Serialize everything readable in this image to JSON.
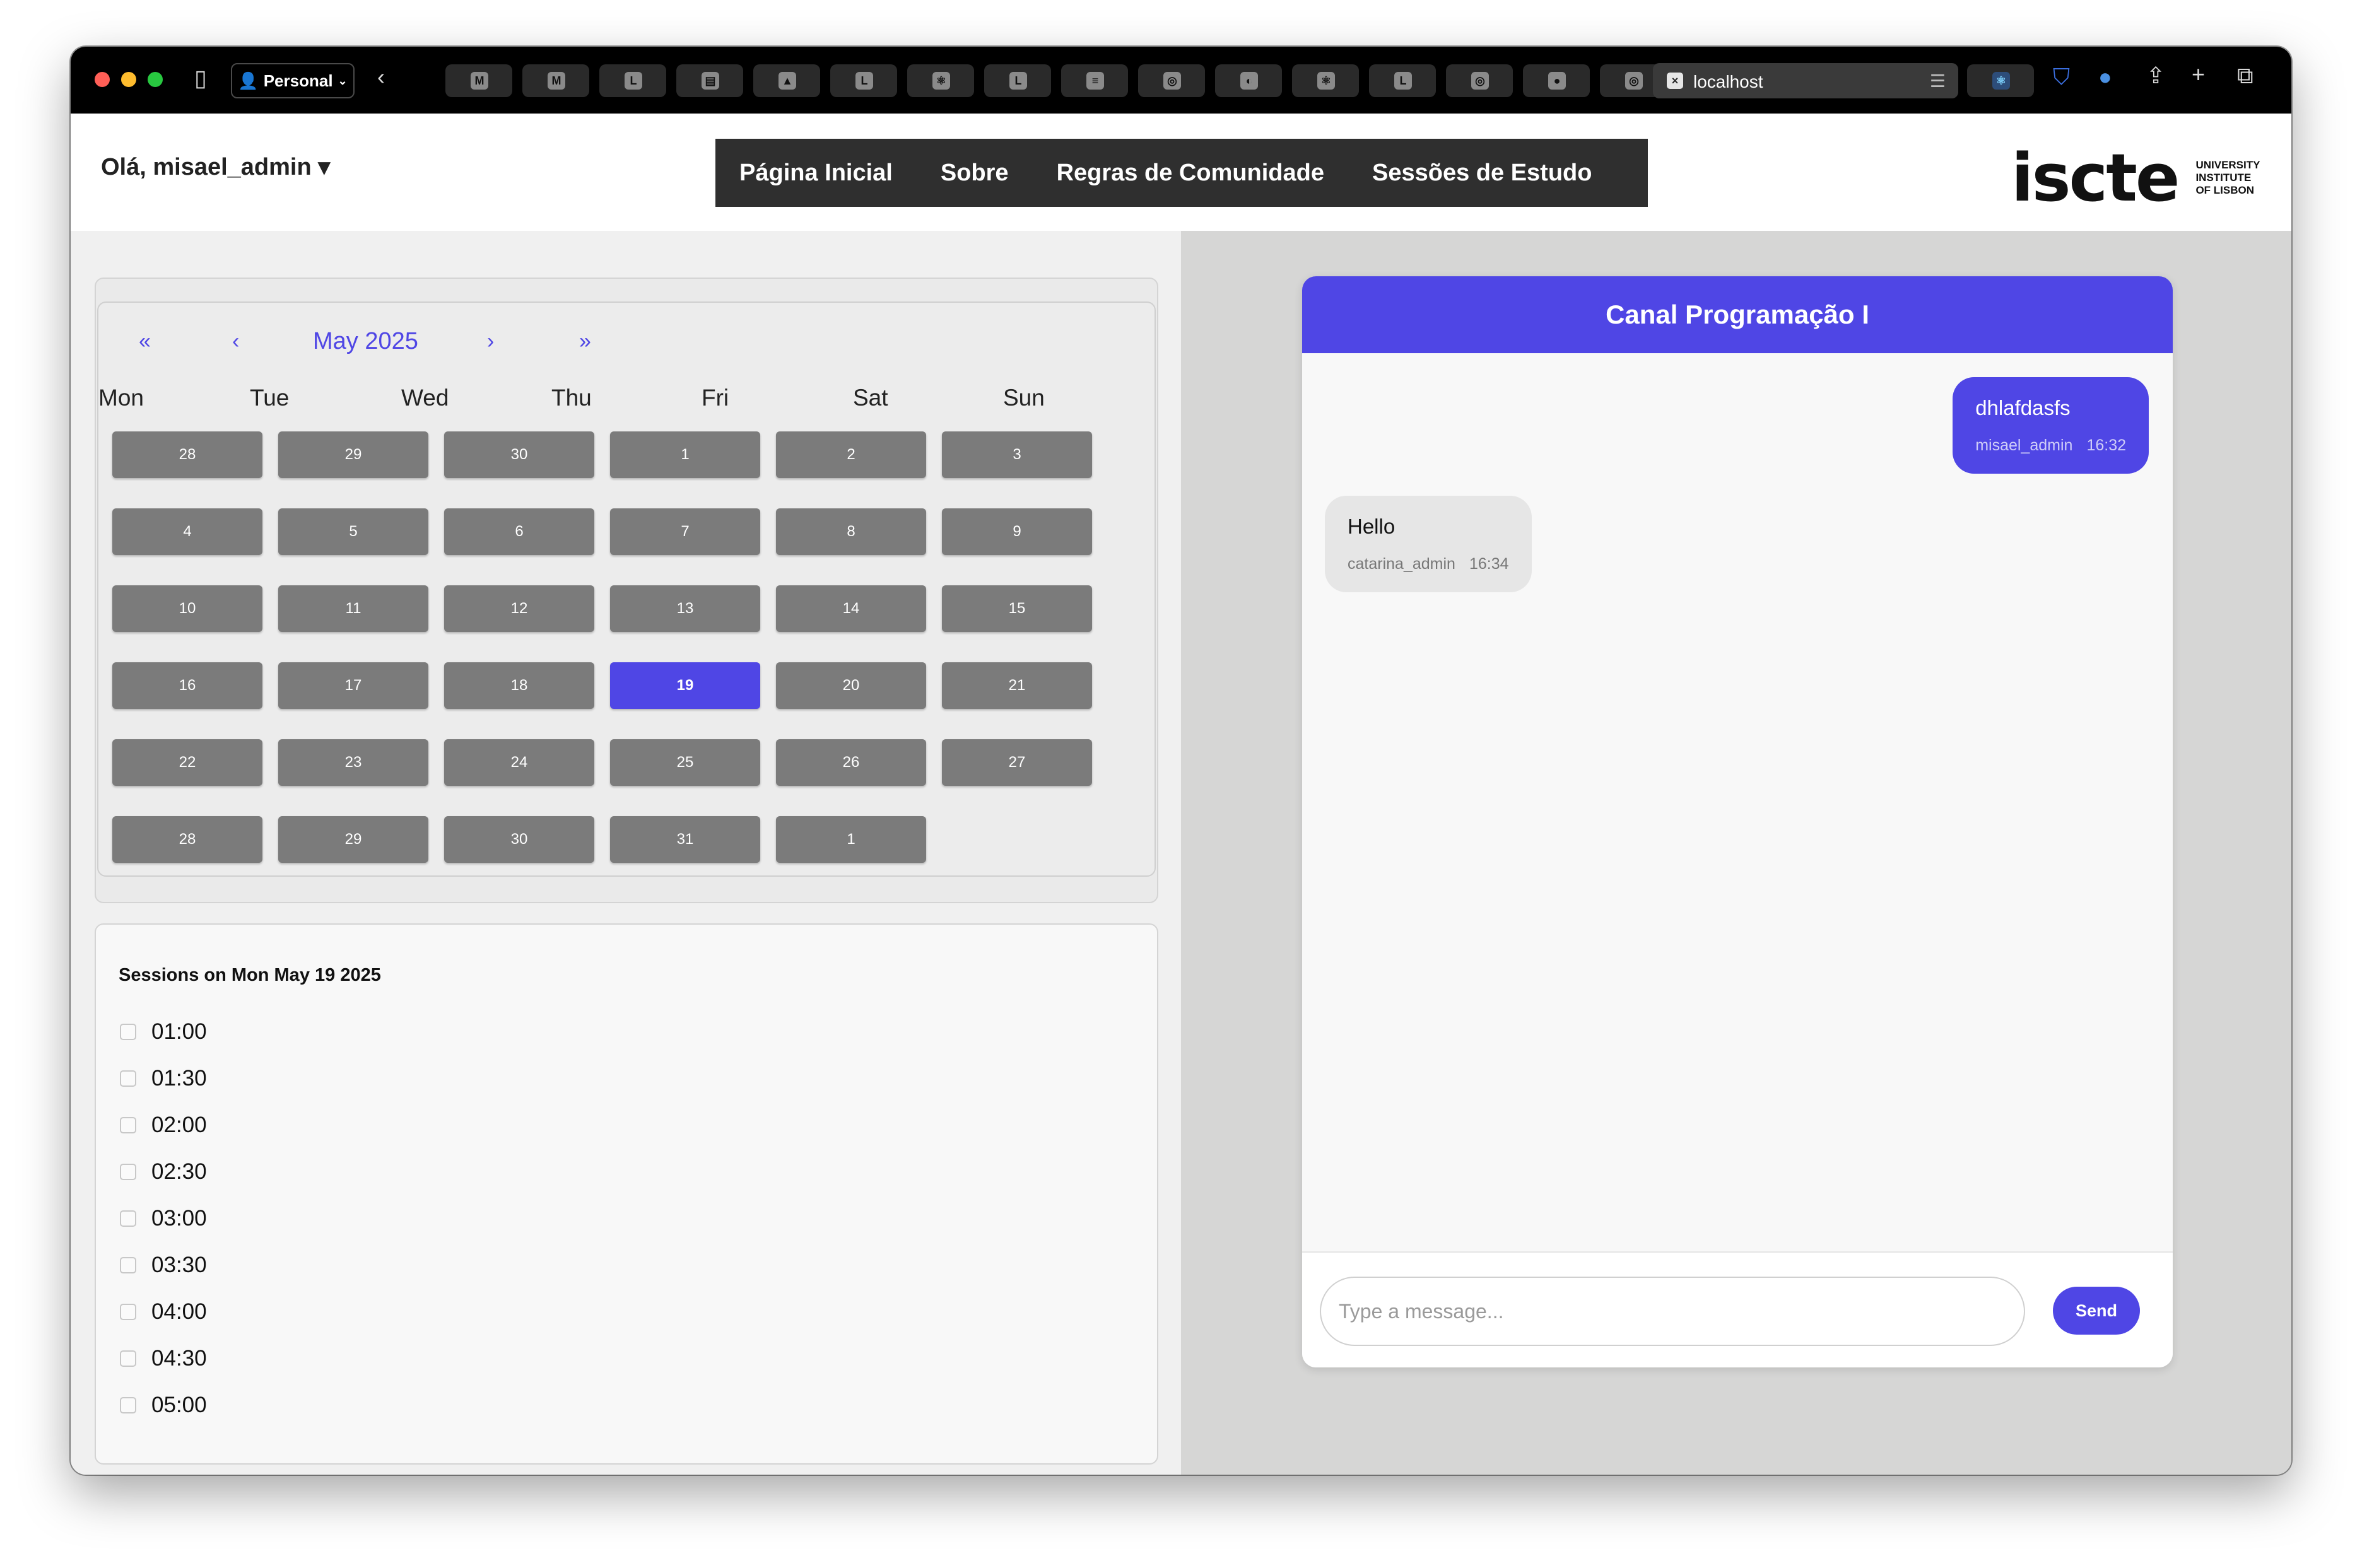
{
  "browser": {
    "profile_label": "Personal",
    "active_tab_title": "localhost",
    "tabs": [
      {
        "icon": "medium-icon",
        "label": "M"
      },
      {
        "icon": "medium-icon",
        "label": "M"
      },
      {
        "icon": "letter-l-icon",
        "label": "L"
      },
      {
        "icon": "book-icon",
        "label": "▤"
      },
      {
        "icon": "purple-app-icon",
        "label": "▲"
      },
      {
        "icon": "letter-l-icon",
        "label": "L"
      },
      {
        "icon": "react-icon",
        "label": "⚛"
      },
      {
        "icon": "letter-l-icon",
        "label": "L"
      },
      {
        "icon": "stackoverflow-icon",
        "label": "≡"
      },
      {
        "icon": "openai-icon",
        "label": "◎"
      },
      {
        "icon": "duckduckgo-icon",
        "label": "◐"
      },
      {
        "icon": "react-icon",
        "label": "⚛"
      },
      {
        "icon": "letter-l-icon",
        "label": "L"
      },
      {
        "icon": "openai-icon",
        "label": "◎"
      },
      {
        "icon": "red-app-icon",
        "label": "●"
      },
      {
        "icon": "openai-icon",
        "label": "◎"
      }
    ]
  },
  "header": {
    "greeting": "Olá, misael_admin ▾",
    "nav": [
      "Página Inicial",
      "Sobre",
      "Regras de Comunidade",
      "Sessões de Estudo"
    ],
    "logo_word": "iscte",
    "logo_sub": [
      "UNIVERSITY",
      "INSTITUTE",
      "OF LISBON"
    ]
  },
  "calendar": {
    "nav_first": "«",
    "nav_prev": "‹",
    "month_label": "May 2025",
    "nav_next": "›",
    "nav_last": "»",
    "weekdays": [
      "Mon",
      "Tue",
      "Wed",
      "Thu",
      "Fri",
      "Sat",
      "Sun"
    ],
    "weeks": [
      [
        "28",
        "29",
        "30",
        "1",
        "2",
        "3"
      ],
      [
        "4",
        "5",
        "6",
        "7",
        "8",
        "9"
      ],
      [
        "10",
        "11",
        "12",
        "13",
        "14",
        "15"
      ],
      [
        "16",
        "17",
        "18",
        "19",
        "20",
        "21"
      ],
      [
        "22",
        "23",
        "24",
        "25",
        "26",
        "27"
      ],
      [
        "28",
        "29",
        "30",
        "31",
        "1"
      ]
    ],
    "selected_day": "19",
    "accent": "#4f46e5",
    "day_color": "#7b7b7b"
  },
  "sessions": {
    "title": "Sessions on Mon May 19 2025",
    "slots": [
      "01:00",
      "01:30",
      "02:00",
      "02:30",
      "03:00",
      "03:30",
      "04:00",
      "04:30",
      "05:00"
    ]
  },
  "chat": {
    "channel_title": "Canal Programação I",
    "messages": [
      {
        "text": "dhlafdasfs",
        "author": "misael_admin",
        "time": "16:32",
        "direction": "outgoing"
      },
      {
        "text": "Hello",
        "author": "catarina_admin",
        "time": "16:34",
        "direction": "incoming"
      }
    ],
    "input_placeholder": "Type a message...",
    "send_label": "Send"
  }
}
